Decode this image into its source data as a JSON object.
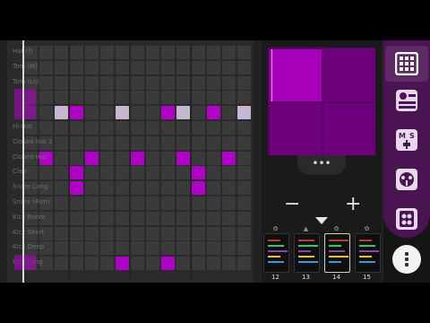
{
  "grid": {
    "rows": [
      {
        "label": "Hat (f)"
      },
      {
        "label": "Tom (M)"
      },
      {
        "label": "Tom (Lo)"
      },
      {
        "label": ""
      },
      {
        "label": ""
      },
      {
        "label": "Hi-Hat"
      },
      {
        "label": "Closed Hat 2"
      },
      {
        "label": "Closed Hat"
      },
      {
        "label": "Clap"
      },
      {
        "label": "Snare Long"
      },
      {
        "label": "Snare (Rim)"
      },
      {
        "label": "Kick Boom"
      },
      {
        "label": "Kick Short"
      },
      {
        "label": "Kick Deep"
      },
      {
        "label": "Kick Long"
      }
    ]
  },
  "patterns": [
    {
      "number": "12",
      "icon": "gear-icon"
    },
    {
      "number": "13",
      "icon": "warning-icon"
    },
    {
      "number": "14",
      "icon": "gear-icon"
    },
    {
      "number": "15",
      "icon": "settings-icon"
    }
  ],
  "controls": {
    "minus": "−",
    "plus": "+",
    "more": "•••"
  },
  "colors": {
    "accent": "#b000c8",
    "ghost": "#c7b6cf",
    "sidebar": "#4a1452"
  }
}
